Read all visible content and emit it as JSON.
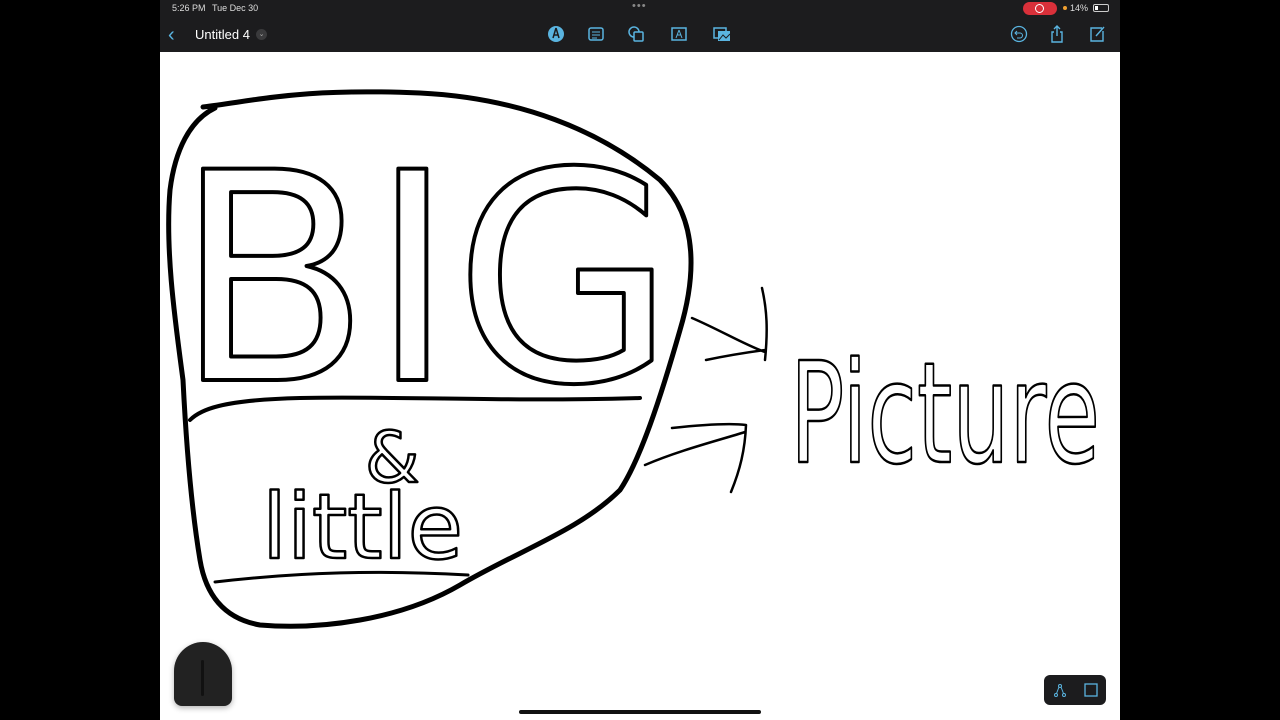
{
  "status": {
    "time": "5:26 PM",
    "date": "Tue Dec 30",
    "battery": "14%"
  },
  "toolbar": {
    "document_title": "Untitled 4"
  },
  "handwriting": {
    "top_word": "BIG",
    "bottom_words": "& little",
    "side_word": "Picture"
  },
  "colors": {
    "accent": "#5ab4e0",
    "toolbar": "#1c1c1e",
    "ink": "#000000",
    "record": "#d9303a"
  }
}
